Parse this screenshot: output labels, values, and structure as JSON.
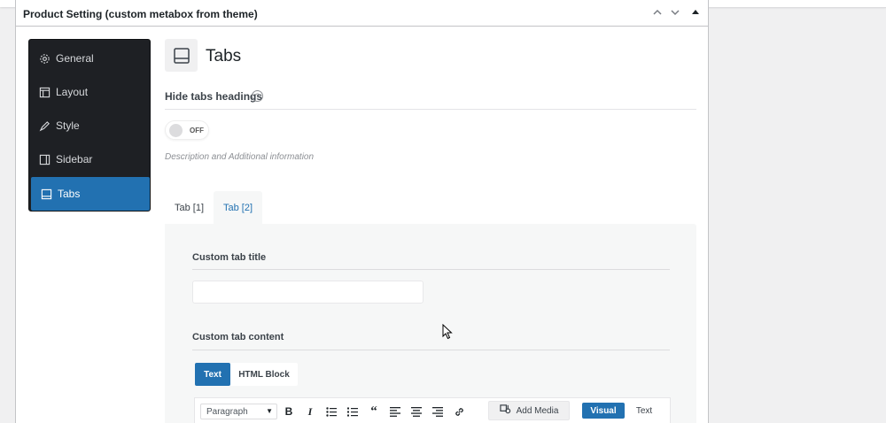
{
  "metabox": {
    "title": "Product Setting (custom metabox from theme)"
  },
  "sidebar": {
    "items": [
      {
        "label": "General",
        "icon": "gear-icon"
      },
      {
        "label": "Layout",
        "icon": "layout-icon"
      },
      {
        "label": "Style",
        "icon": "brush-icon"
      },
      {
        "label": "Sidebar",
        "icon": "sidebar-icon"
      },
      {
        "label": "Tabs",
        "icon": "tabs-icon",
        "active": true
      }
    ]
  },
  "section": {
    "title": "Tabs",
    "hide_label": "Hide tabs headings",
    "help": "?",
    "toggle_state": "OFF",
    "description": "Description and Additional information"
  },
  "tabs": [
    {
      "label": "Tab [1]"
    },
    {
      "label": "Tab [2]",
      "active": true
    }
  ],
  "panel": {
    "title_label": "Custom tab title",
    "title_value": "",
    "content_label": "Custom tab content",
    "mode_text": "Text",
    "mode_html": "HTML Block"
  },
  "editor": {
    "paragraph": "Paragraph",
    "add_media": "Add Media",
    "visual": "Visual",
    "text": "Text"
  },
  "colors": {
    "accent": "#2271b1",
    "sidebar_bg": "#1e2024"
  }
}
